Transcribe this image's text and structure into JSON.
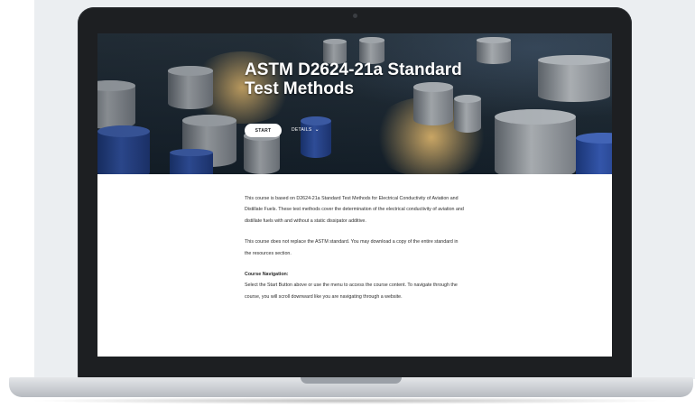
{
  "hero": {
    "title": "ASTM D2624-21a Standard Test Methods",
    "start_label": "START",
    "details_label": "DETAILS"
  },
  "content": {
    "paragraph1": "This course is based on D2624-21a Standard Test Methods for Electrical Conductivity of Aviation and Distillate Fuels. These test methods cover the determination of the electrical conductivity of aviation and distillate fuels with and without a static dissipator additive.",
    "paragraph2": "This course does not replace the ASTM standard. You may download a copy of the entire standard in the resources section.",
    "nav_heading": "Course Navigation:",
    "nav_text": "Select the Start Button above or use the menu to access the course content. To navigate through the course, you will scroll downward like you are navigating through a website."
  },
  "colors": {
    "laptop_bezel": "#1d1f22",
    "hero_dark": "#16222c",
    "tank_blue": "#3b62c4",
    "button_bg": "#ffffff",
    "text": "#2b2b2b"
  },
  "icons": {
    "details_chevron": "chevron-down-icon"
  }
}
